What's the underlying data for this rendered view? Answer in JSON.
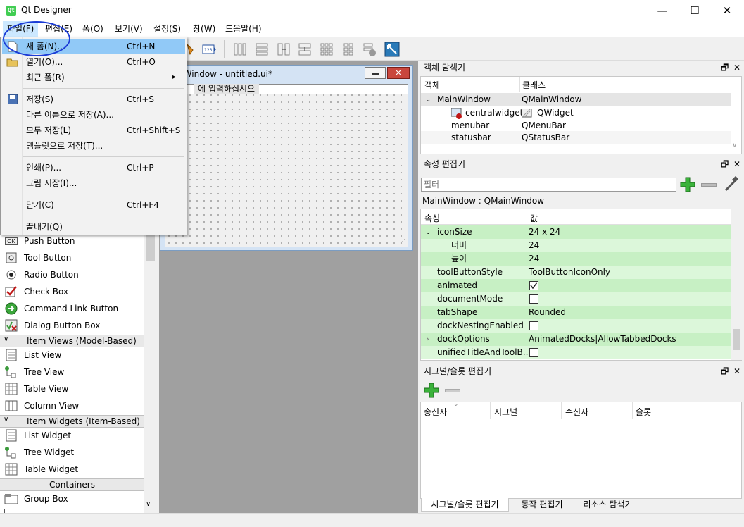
{
  "window": {
    "title": "Qt Designer",
    "minimize": "—",
    "maximize": "☐",
    "close": "✕",
    "app_icon_text": "Qt"
  },
  "menubar": [
    "파일(F)",
    "편집(E)",
    "폼(O)",
    "보기(V)",
    "설정(S)",
    "창(W)",
    "도움말(H)"
  ],
  "file_menu": {
    "items": [
      {
        "label": "새 폼(N)...",
        "shortcut": "Ctrl+N"
      },
      {
        "label": "열기(O)...",
        "shortcut": "Ctrl+O"
      },
      {
        "label": "최근 폼(R)",
        "shortcut": "",
        "submenu_arrow": "▸"
      },
      {
        "label": "저장(S)",
        "shortcut": "Ctrl+S"
      },
      {
        "label": "다른 이름으로 저장(A)...",
        "shortcut": ""
      },
      {
        "label": "모두 저장(L)",
        "shortcut": "Ctrl+Shift+S"
      },
      {
        "label": "템플릿으로 저장(T)...",
        "shortcut": ""
      },
      {
        "label": "인쇄(P)...",
        "shortcut": "Ctrl+P"
      },
      {
        "label": "그림 저장(I)...",
        "shortcut": ""
      },
      {
        "label": "닫기(C)",
        "shortcut": "Ctrl+F4"
      },
      {
        "label": "끝내기(Q)",
        "shortcut": ""
      }
    ]
  },
  "widget_box": {
    "buttons": [
      "Push Button",
      "Tool Button",
      "Radio Button",
      "Check Box",
      "Command Link Button",
      "Dialog Button Box"
    ],
    "cat_item_views": "Item Views (Model-Based)",
    "item_views": [
      "List View",
      "Tree View",
      "Table View",
      "Column View"
    ],
    "cat_item_widgets": "Item Widgets (Item-Based)",
    "item_widgets": [
      "List Widget",
      "Tree Widget",
      "Table Widget"
    ],
    "cat_containers": "Containers",
    "containers": [
      "Group Box"
    ],
    "icon_text_ok": "OK"
  },
  "subwindow": {
    "title": "MainWindow - untitled.ui*",
    "menu_placeholder": "에 입력하십시오"
  },
  "object_inspector": {
    "title": "객체 탐색기",
    "col_object": "객체",
    "col_class": "클래스",
    "rows": [
      {
        "object": "MainWindow",
        "class": "QMainWindow"
      },
      {
        "object": "centralwidget",
        "class": "QWidget"
      },
      {
        "object": "menubar",
        "class": "QMenuBar"
      },
      {
        "object": "statusbar",
        "class": "QStatusBar"
      }
    ]
  },
  "property_editor": {
    "title": "속성 편집기",
    "filter_placeholder": "필터",
    "context": "MainWindow : QMainWindow",
    "col_prop": "속성",
    "col_value": "값",
    "rows": [
      {
        "name": "iconSize",
        "value": "24 x 24"
      },
      {
        "name": "너비",
        "value": "24"
      },
      {
        "name": "높이",
        "value": "24"
      },
      {
        "name": "toolButtonStyle",
        "value": "ToolButtonIconOnly"
      },
      {
        "name": "animated",
        "value": ""
      },
      {
        "name": "documentMode",
        "value": ""
      },
      {
        "name": "tabShape",
        "value": "Rounded"
      },
      {
        "name": "dockNestingEnabled",
        "value": ""
      },
      {
        "name": "dockOptions",
        "value": "AnimatedDocks|AllowTabbedDocks"
      },
      {
        "name": "unifiedTitleAndToolB...",
        "value": ""
      }
    ]
  },
  "signal_slot_editor": {
    "title": "시그널/슬롯 편집기",
    "cols": [
      "송신자",
      "시그널",
      "수신자",
      "슬롯"
    ]
  },
  "bottom_tabs": [
    "시그널/슬롯 편집기",
    "동작 편집기",
    "리소스 탐색기"
  ],
  "dock_buttons": {
    "float": "🗗",
    "close": "✕"
  },
  "tree_arrows": {
    "expanded": "⌄",
    "collapsed": "›"
  },
  "colors": {
    "highlight": "#91c9f7",
    "prop_green": "#c7f0c4",
    "annotation": "#1a3bd6"
  }
}
